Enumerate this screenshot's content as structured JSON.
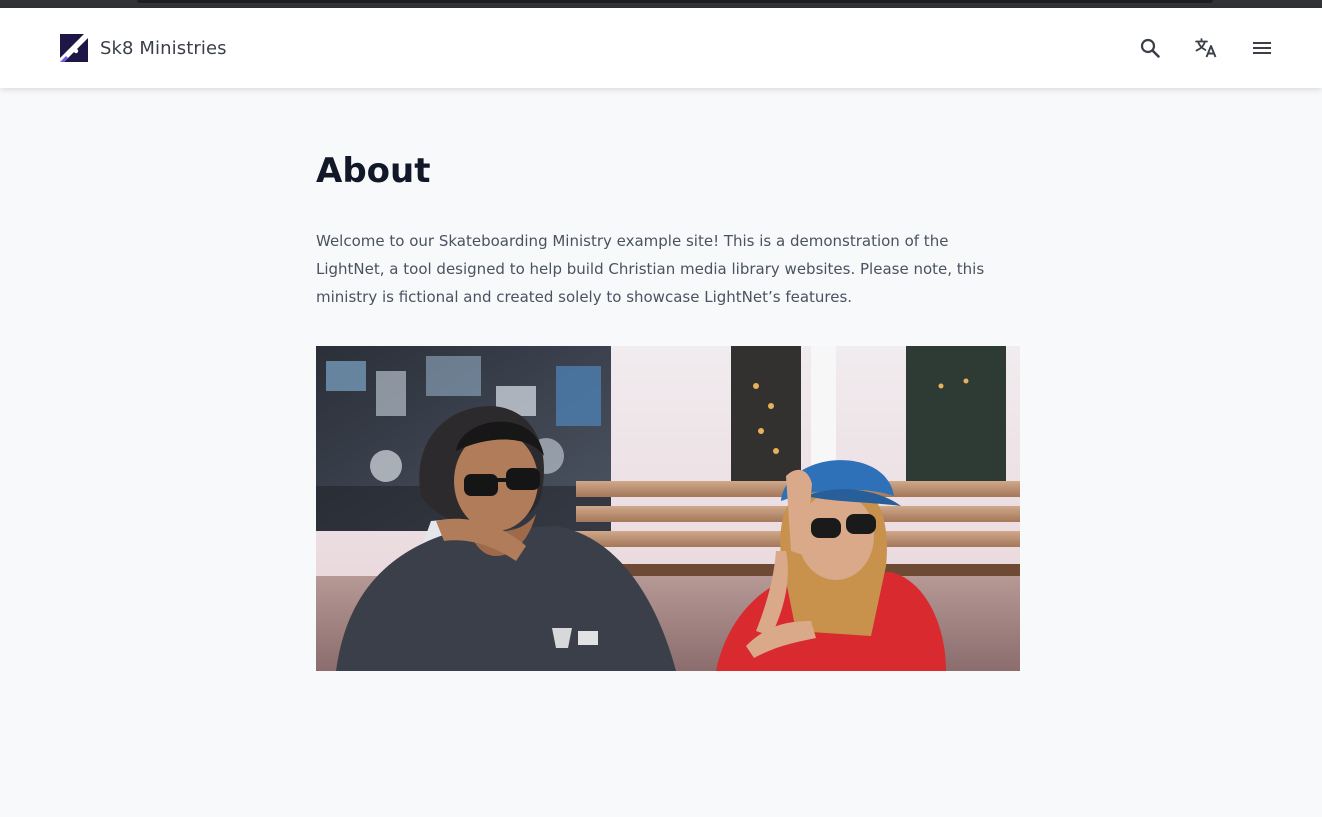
{
  "header": {
    "site_name": "Sk8 Ministries",
    "logo_icon": "skateboard-logo-icon",
    "actions": [
      {
        "icon": "search-icon",
        "label": "Search"
      },
      {
        "icon": "translate-icon",
        "label": "Language"
      },
      {
        "icon": "menu-icon",
        "label": "Menu"
      }
    ]
  },
  "main": {
    "title": "About",
    "intro": "Welcome to our Skateboarding Ministry example site! This is a demonstration of the LightNet, a tool designed to help build Christian media library websites. Please note, this ministry is fictional and created solely to showcase LightNet’s features.",
    "image_description": "two-skaters-sitting-photo"
  },
  "colors": {
    "brand_dark": "#1d1647",
    "header_bg": "#ffffff",
    "page_bg": "#f8f9fb",
    "title": "#111827",
    "body_text": "#4b5260",
    "icon": "#3a3f48"
  }
}
